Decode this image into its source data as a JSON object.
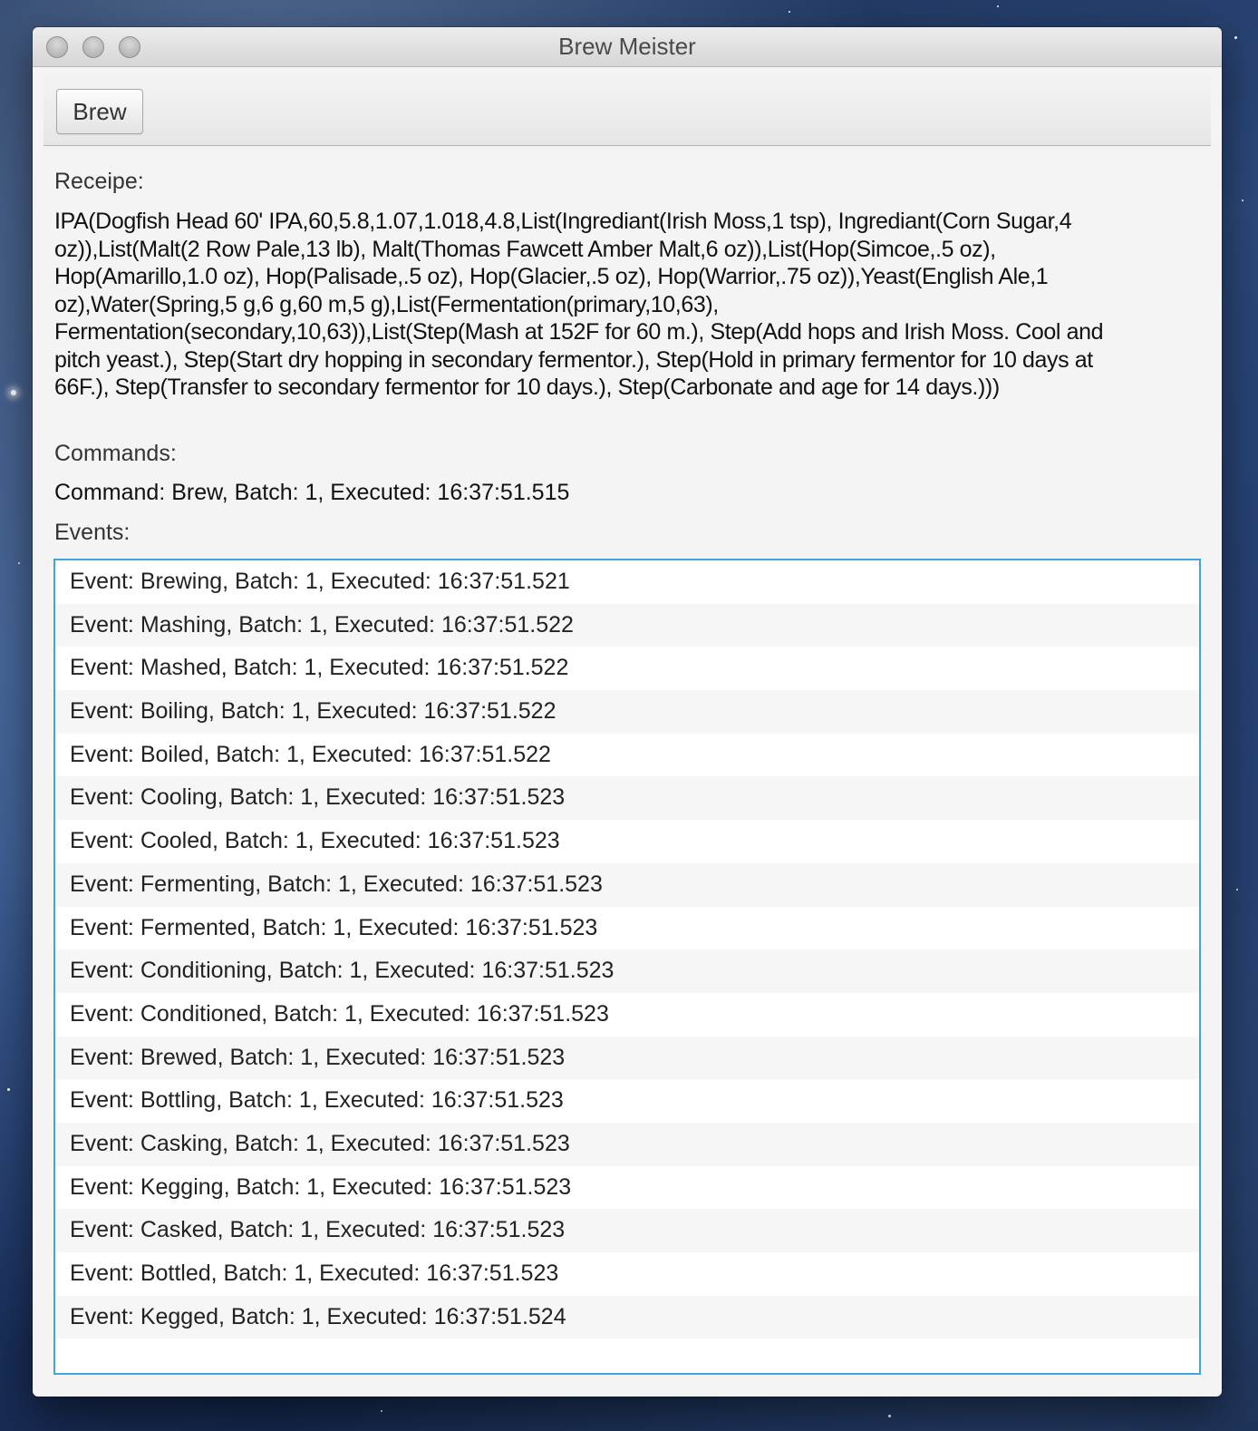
{
  "window": {
    "title": "Brew Meister"
  },
  "toolbar": {
    "brew_label": "Brew"
  },
  "recipe": {
    "label": "Receipe:",
    "text": "IPA(Dogfish Head 60' IPA,60,5.8,1.07,1.018,4.8,List(Ingrediant(Irish Moss,1 tsp), Ingrediant(Corn Sugar,4 oz)),List(Malt(2 Row Pale,13 lb), Malt(Thomas Fawcett Amber Malt,6 oz)),List(Hop(Simcoe,.5 oz), Hop(Amarillo,1.0 oz), Hop(Palisade,.5 oz), Hop(Glacier,.5 oz), Hop(Warrior,.75 oz)),Yeast(English Ale,1 oz),Water(Spring,5 g,6 g,60 m,5 g),List(Fermentation(primary,10,63), Fermentation(secondary,10,63)),List(Step(Mash at 152F for 60 m.), Step(Add hops and Irish Moss. Cool and pitch yeast.), Step(Start dry hopping in secondary fermentor.), Step(Hold in primary fermentor for 10 days at 66F.), Step(Transfer to secondary fermentor for 10 days.), Step(Carbonate and age for 14 days.)))"
  },
  "commands": {
    "label": "Commands:",
    "text": "Command: Brew, Batch: 1, Executed: 16:37:51.515"
  },
  "events": {
    "label": "Events:",
    "items": [
      "Event: Brewing, Batch: 1, Executed: 16:37:51.521",
      "Event: Mashing, Batch: 1, Executed: 16:37:51.522",
      "Event: Mashed, Batch: 1, Executed: 16:37:51.522",
      "Event: Boiling, Batch: 1, Executed: 16:37:51.522",
      "Event: Boiled, Batch: 1, Executed: 16:37:51.522",
      "Event: Cooling, Batch: 1, Executed: 16:37:51.523",
      "Event: Cooled, Batch: 1, Executed: 16:37:51.523",
      "Event: Fermenting, Batch: 1, Executed: 16:37:51.523",
      "Event: Fermented, Batch: 1, Executed: 16:37:51.523",
      "Event: Conditioning, Batch: 1, Executed: 16:37:51.523",
      "Event: Conditioned, Batch: 1, Executed: 16:37:51.523",
      "Event: Brewed, Batch: 1, Executed: 16:37:51.523",
      "Event: Bottling, Batch: 1, Executed: 16:37:51.523",
      "Event: Casking, Batch: 1, Executed: 16:37:51.523",
      "Event: Kegging, Batch: 1, Executed: 16:37:51.523",
      "Event: Casked, Batch: 1, Executed: 16:37:51.523",
      "Event: Bottled, Batch: 1, Executed: 16:37:51.523",
      "Event: Kegged, Batch: 1, Executed: 16:37:51.524"
    ]
  }
}
